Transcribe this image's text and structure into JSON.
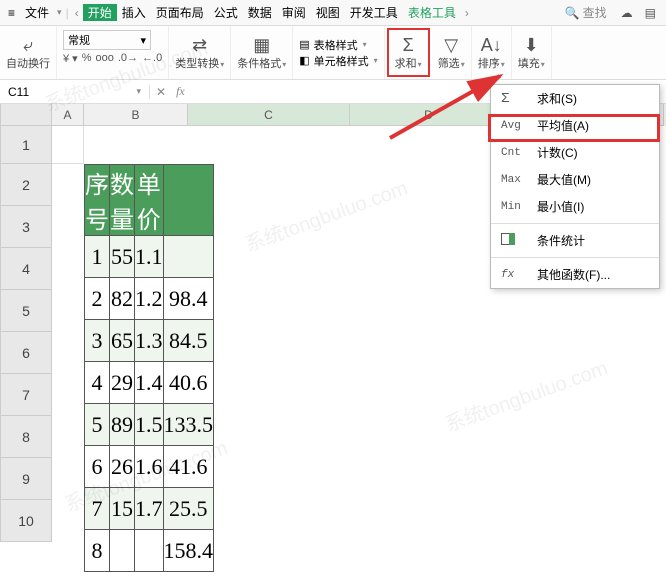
{
  "menubar": {
    "file": "文件",
    "tabs": [
      "开始",
      "插入",
      "页面布局",
      "公式",
      "数据",
      "审阅",
      "视图",
      "开发工具"
    ],
    "tabletool": "表格工具",
    "search": "查找"
  },
  "ribbon": {
    "autowrap": "自动换行",
    "normal": "常规",
    "typeconv": "类型转换",
    "condfmt": "条件格式",
    "tablestyle": "表格样式",
    "cellstyle": "单元格样式",
    "sum": "求和",
    "filter": "筛选",
    "sort": "排序",
    "fill": "填充"
  },
  "namebox": {
    "cell": "C11"
  },
  "columns": [
    "A",
    "B",
    "C",
    "D"
  ],
  "rownums": [
    "1",
    "2",
    "3",
    "4",
    "5",
    "6",
    "7",
    "8",
    "9",
    "10"
  ],
  "table": {
    "headers": [
      "序号",
      "数量",
      "单价",
      ""
    ],
    "rows": [
      [
        "1",
        "55",
        "1.1",
        ""
      ],
      [
        "2",
        "82",
        "1.2",
        "98.4"
      ],
      [
        "3",
        "65",
        "1.3",
        "84.5"
      ],
      [
        "4",
        "29",
        "1.4",
        "40.6"
      ],
      [
        "5",
        "89",
        "1.5",
        "133.5"
      ],
      [
        "6",
        "26",
        "1.6",
        "41.6"
      ],
      [
        "7",
        "15",
        "1.7",
        "25.5"
      ],
      [
        "8",
        "",
        "",
        "158.4"
      ]
    ]
  },
  "dropdown": {
    "items": [
      {
        "k": "Σ",
        "label": "求和(S)"
      },
      {
        "k": "Avg",
        "label": "平均值(A)"
      },
      {
        "k": "Cnt",
        "label": "计数(C)"
      },
      {
        "k": "Max",
        "label": "最大值(M)"
      },
      {
        "k": "Min",
        "label": "最小值(I)"
      },
      {
        "k": "cond",
        "label": "条件统计"
      },
      {
        "k": "fx",
        "label": "其他函数(F)..."
      }
    ]
  }
}
